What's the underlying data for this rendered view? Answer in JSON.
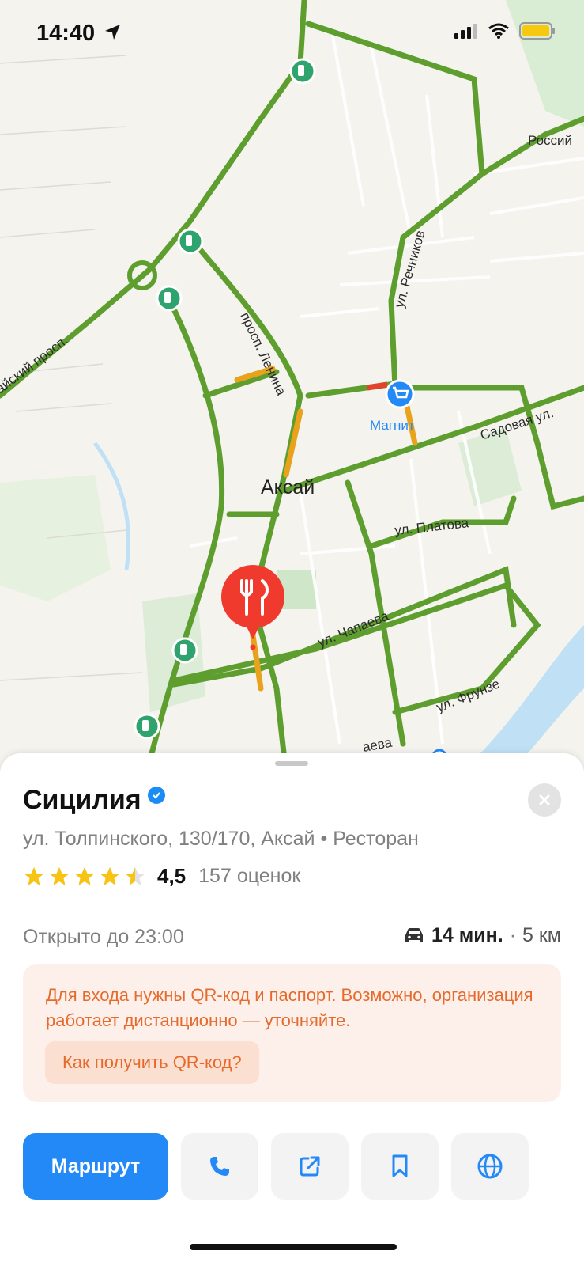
{
  "status_bar": {
    "time": "14:40"
  },
  "map": {
    "streets": {
      "prosp_lenina": "просп. Ленина",
      "aysky_prosp": "айский просп.",
      "rechnikov": "ул. Речников",
      "sadovaya": "Садовая ул.",
      "platova": "ул. Платова",
      "chapaeva": "ул. Чапаева",
      "frunze": "ул. Фрунзе",
      "bottom_partial": "аева",
      "rossiy": "Россий"
    },
    "city_label": "Аксай",
    "poi_magnit": "Магнит"
  },
  "place": {
    "title": "Сицилия",
    "address": "ул. Толпинского, 130/170, Аксай",
    "category": "Ресторан",
    "separator": "•",
    "rating": "4,5",
    "rating_stars": 4.5,
    "rating_count": "157 оценок",
    "hours": "Открыто до 23:00",
    "travel_time": "14 мин.",
    "travel_separator": "·",
    "distance": "5 км"
  },
  "notice": {
    "text": "Для входа нужны QR-код и паспорт. Возможно, организация работает дистанционно — уточняйте.",
    "button": "Как получить QR-код?"
  },
  "actions": {
    "route": "Маршрут"
  },
  "colors": {
    "road_green": "#5e9e2f",
    "road_orange": "#e8a21b",
    "road_red": "#e0442a",
    "accent_blue": "#2389f7",
    "notice_orange": "#e66a2c",
    "pin_red": "#f03a2e"
  }
}
